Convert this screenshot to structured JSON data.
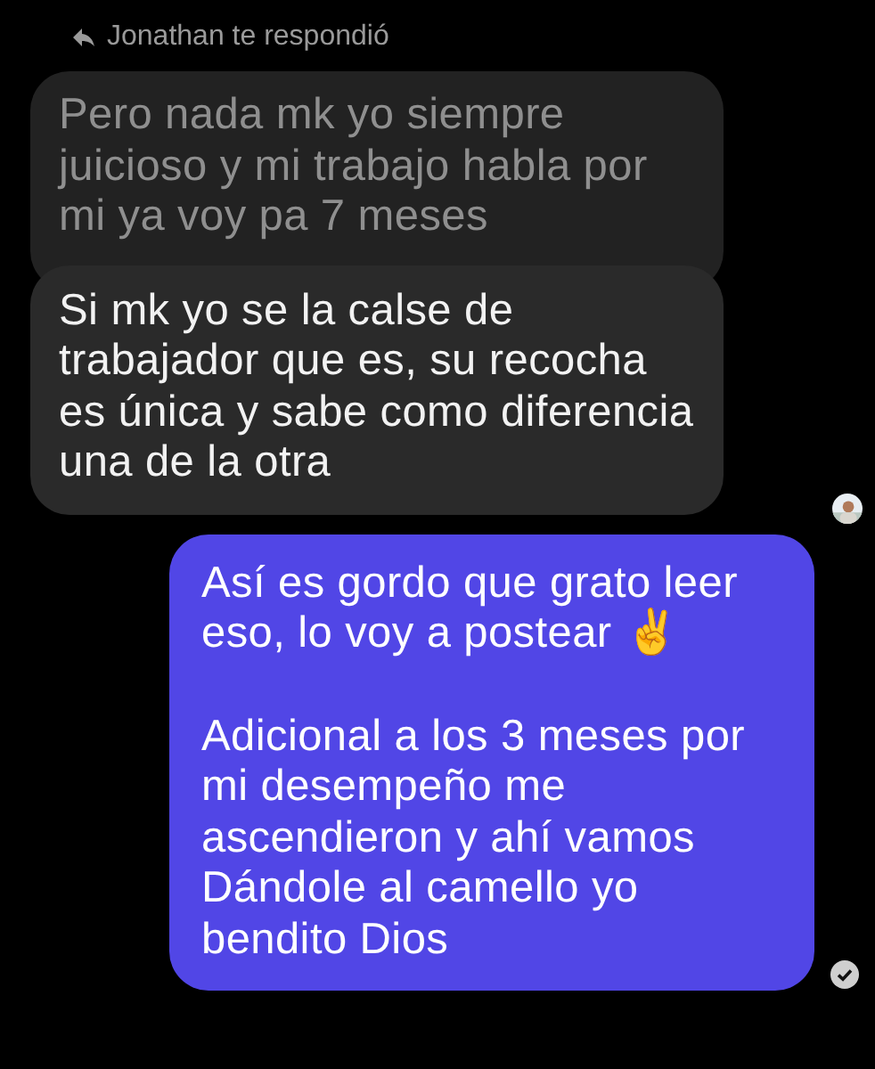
{
  "reply_header": {
    "text": "Jonathan te respondió"
  },
  "quoted_message": {
    "text": "Pero nada mk yo siempre juicioso y mi trabajo habla por mi ya voy pa 7 meses"
  },
  "incoming_message": {
    "text": "Si mk yo se la calse de trabajador que es, su recocha es única y sabe como diferencia una de la otra"
  },
  "outgoing_message": {
    "paragraphs": [
      "Así es gordo que grato leer eso, lo voy a postear ✌️",
      "Adicional a los 3 meses por mi desempeño me ascendieron y ahí vamos Dándole al camello yo bendito Dios"
    ],
    "read": true
  }
}
